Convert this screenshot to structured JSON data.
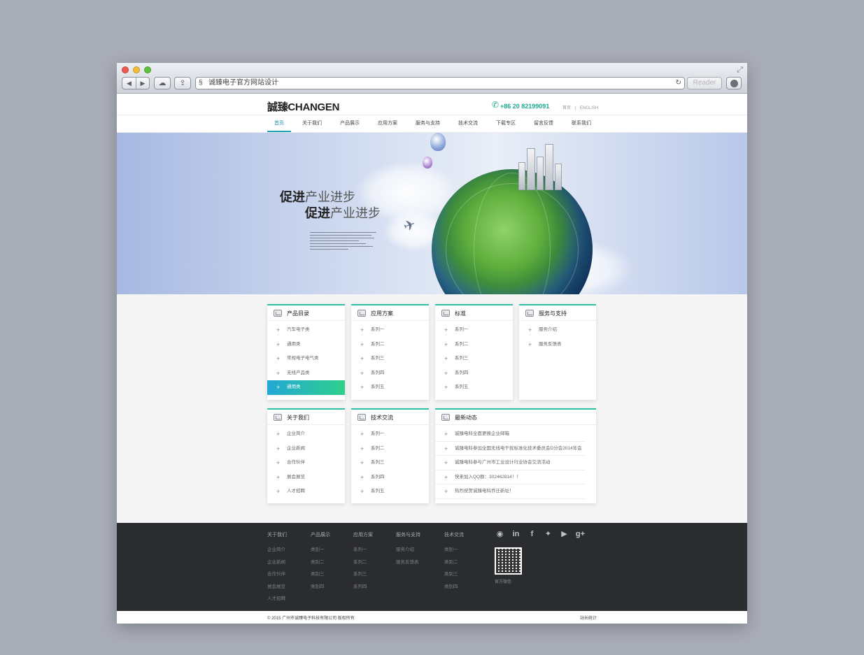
{
  "browser": {
    "address": "诚臻电子官方网站设计",
    "reader_label": "Reader"
  },
  "header": {
    "logo": "誠臻CHANGEN",
    "phone": "+86 20 82199091",
    "home_link": "首页",
    "separator": "|",
    "english_link": "ENGLISH"
  },
  "nav": {
    "items": [
      "首页",
      "关于我们",
      "产品展示",
      "应用方案",
      "服务与支持",
      "技术交流",
      "下载专区",
      "留言反馈",
      "联系我们"
    ]
  },
  "banner": {
    "slogan_bold": "促进",
    "slogan_rest": "产业进步"
  },
  "cards": {
    "products": {
      "title": "产品目录",
      "items": [
        "汽车电子类",
        "通用类",
        "常规电子电气类",
        "无线产品类",
        "通用类"
      ]
    },
    "solutions": {
      "title": "应用方案",
      "items": [
        "系列一",
        "系列二",
        "系列三",
        "系列四",
        "系列五"
      ]
    },
    "standards": {
      "title": "标准",
      "items": [
        "系列一",
        "系列二",
        "系列三",
        "系列四",
        "系列五"
      ]
    },
    "service": {
      "title": "服务与支持",
      "items": [
        "服务介绍",
        "服务反馈表"
      ]
    },
    "about": {
      "title": "关于我们",
      "items": [
        "企业简介",
        "企业新闻",
        "合作伙伴",
        "展会展览",
        "人才招聘"
      ]
    },
    "tech": {
      "title": "技术交流",
      "items": [
        "系列一",
        "系列二",
        "系列三",
        "系列四",
        "系列五"
      ]
    },
    "news": {
      "title": "最新动态",
      "items": [
        "诚臻电科全面更换企业邮箱",
        "诚臻电科参加全国无线电干扰标准化技术委员会D分会2014年会",
        "诚臻电科参与广州市工业设计行业协会交流活动",
        "快来加入QQ群：302462814！！",
        "热烈祝贺诚臻电科乔迁新址！"
      ]
    }
  },
  "footer": {
    "cols": [
      {
        "title": "关于我们",
        "items": [
          "企业简介",
          "企业新闻",
          "合作伙伴",
          "展会展览",
          "人才招聘"
        ]
      },
      {
        "title": "产品展示",
        "items": [
          "类别一",
          "类别二",
          "类别三",
          "类别四"
        ]
      },
      {
        "title": "应用方案",
        "items": [
          "系列一",
          "系列二",
          "系列三",
          "系列四"
        ]
      },
      {
        "title": "服务与支持",
        "items": [
          "服务介绍",
          "服务反馈表"
        ]
      },
      {
        "title": "技术交流",
        "items": [
          "类别一",
          "类别二",
          "类别三",
          "类别四"
        ]
      }
    ],
    "social_icons": [
      "weibo-icon",
      "linkedin-icon",
      "facebook-icon",
      "twitter-icon",
      "youtube-icon",
      "google-plus-icon"
    ],
    "qr_label": "官方微信",
    "copyright": "© 2015 广州市诚臻电子科技有限公司  版权所有",
    "stats": "站长统计"
  },
  "colors": {
    "accent": "#1aaa8c",
    "card_top": "#2fc0a6",
    "footer_bg": "#2b2c30"
  }
}
